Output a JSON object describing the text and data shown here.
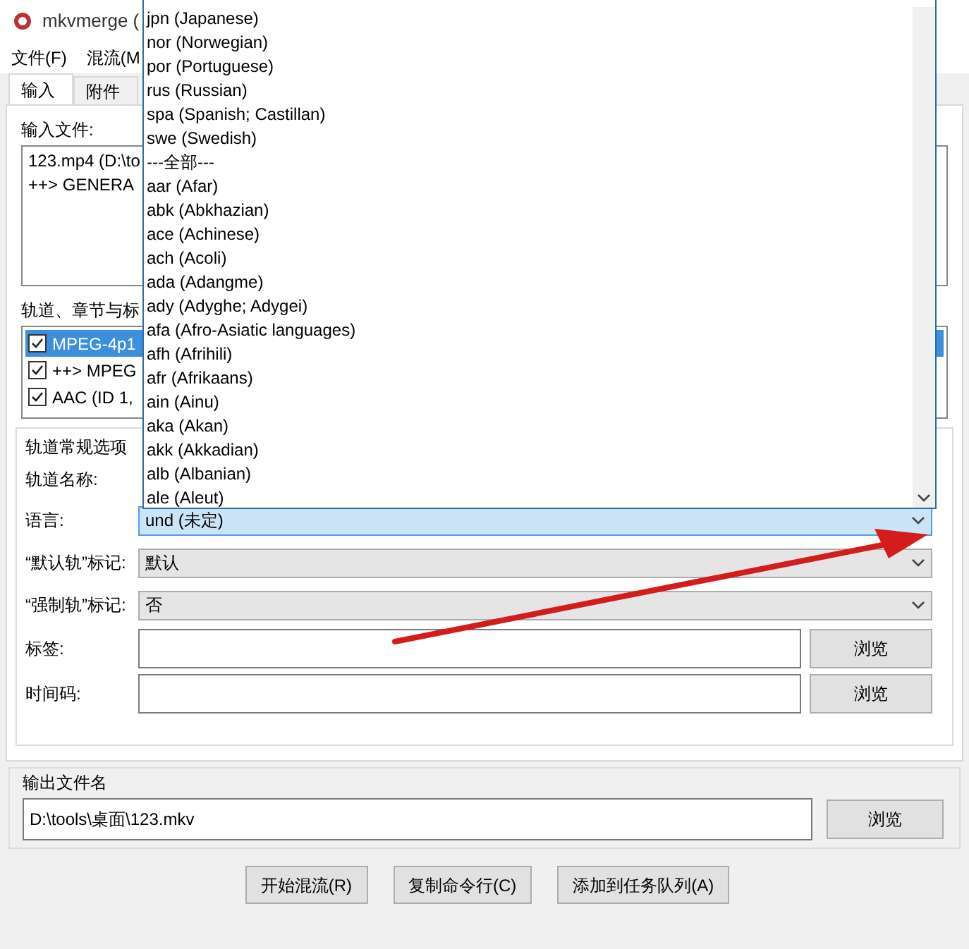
{
  "window": {
    "title": "mkvmerge ("
  },
  "menu": [
    "文件(F)",
    "混流(M"
  ],
  "tabs": [
    {
      "label": "输入",
      "selected": true
    },
    {
      "label": "附件",
      "selected": false
    }
  ],
  "input_files": {
    "label": "输入文件:",
    "items": [
      "123.mp4 (D:\\to",
      "++> GENERA"
    ]
  },
  "tracks": {
    "label": "轨道、章节与标",
    "items": [
      {
        "label": "MPEG-4p1",
        "checked": true,
        "selected": true
      },
      {
        "label": "++> MPEG",
        "checked": true,
        "selected": false
      },
      {
        "label": "AAC (ID 1,",
        "checked": true,
        "selected": false
      }
    ]
  },
  "general_options": {
    "title": "轨道常规选项",
    "track_name_label": "轨道名称:",
    "fields": [
      {
        "kind": "combo",
        "label": "语言:",
        "value": "und (未定)",
        "focused": true
      },
      {
        "kind": "combo",
        "label": "“默认轨”标记:",
        "value": "默认",
        "focused": false
      },
      {
        "kind": "combo",
        "label": "“强制轨”标记:",
        "value": "否",
        "focused": false
      },
      {
        "kind": "text",
        "label": "标签:",
        "button": "浏览"
      },
      {
        "kind": "text",
        "label": "时间码:",
        "button": "浏览"
      }
    ]
  },
  "language_dropdown": {
    "items": [
      "jpn (Japanese)",
      "nor (Norwegian)",
      "por (Portuguese)",
      "rus (Russian)",
      "spa (Spanish; Castillan)",
      "swe (Swedish)",
      "---全部---",
      "aar (Afar)",
      "abk (Abkhazian)",
      "ace (Achinese)",
      "ach (Acoli)",
      "ada (Adangme)",
      "ady (Adyghe; Adygei)",
      "afa (Afro-Asiatic languages)",
      "afh (Afrihili)",
      "afr (Afrikaans)",
      "ain (Ainu)",
      "aka (Akan)",
      "akk (Akkadian)",
      "alb (Albanian)",
      "ale (Aleut)"
    ]
  },
  "output": {
    "title": "输出文件名",
    "value": "D:\\tools\\桌面\\123.mkv",
    "button": "浏览"
  },
  "actions": [
    "开始混流(R)",
    "复制命令行(C)",
    "添加到任务队列(A)"
  ]
}
